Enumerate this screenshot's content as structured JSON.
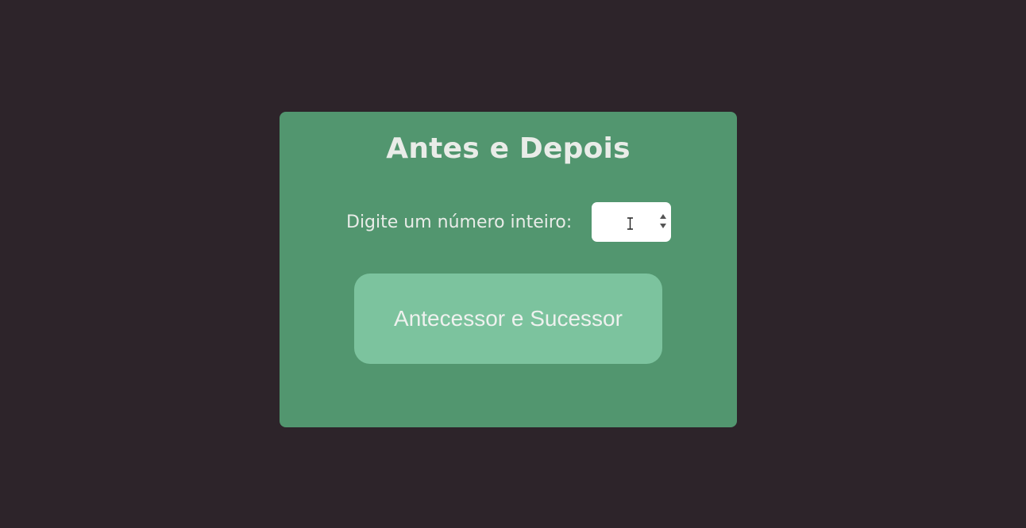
{
  "card": {
    "title": "Antes e Depois",
    "input_label": "Digite um número inteiro:",
    "input_value": "",
    "button_label": "Antecessor e Sucessor"
  },
  "colors": {
    "page_background": "#2d242a",
    "card_background": "#52966f",
    "button_background": "#7cc39e",
    "text": "#e9ece8"
  },
  "icons": {
    "input_cursor": "text-cursor-icon",
    "spinner": "spinner-arrows-icon"
  }
}
